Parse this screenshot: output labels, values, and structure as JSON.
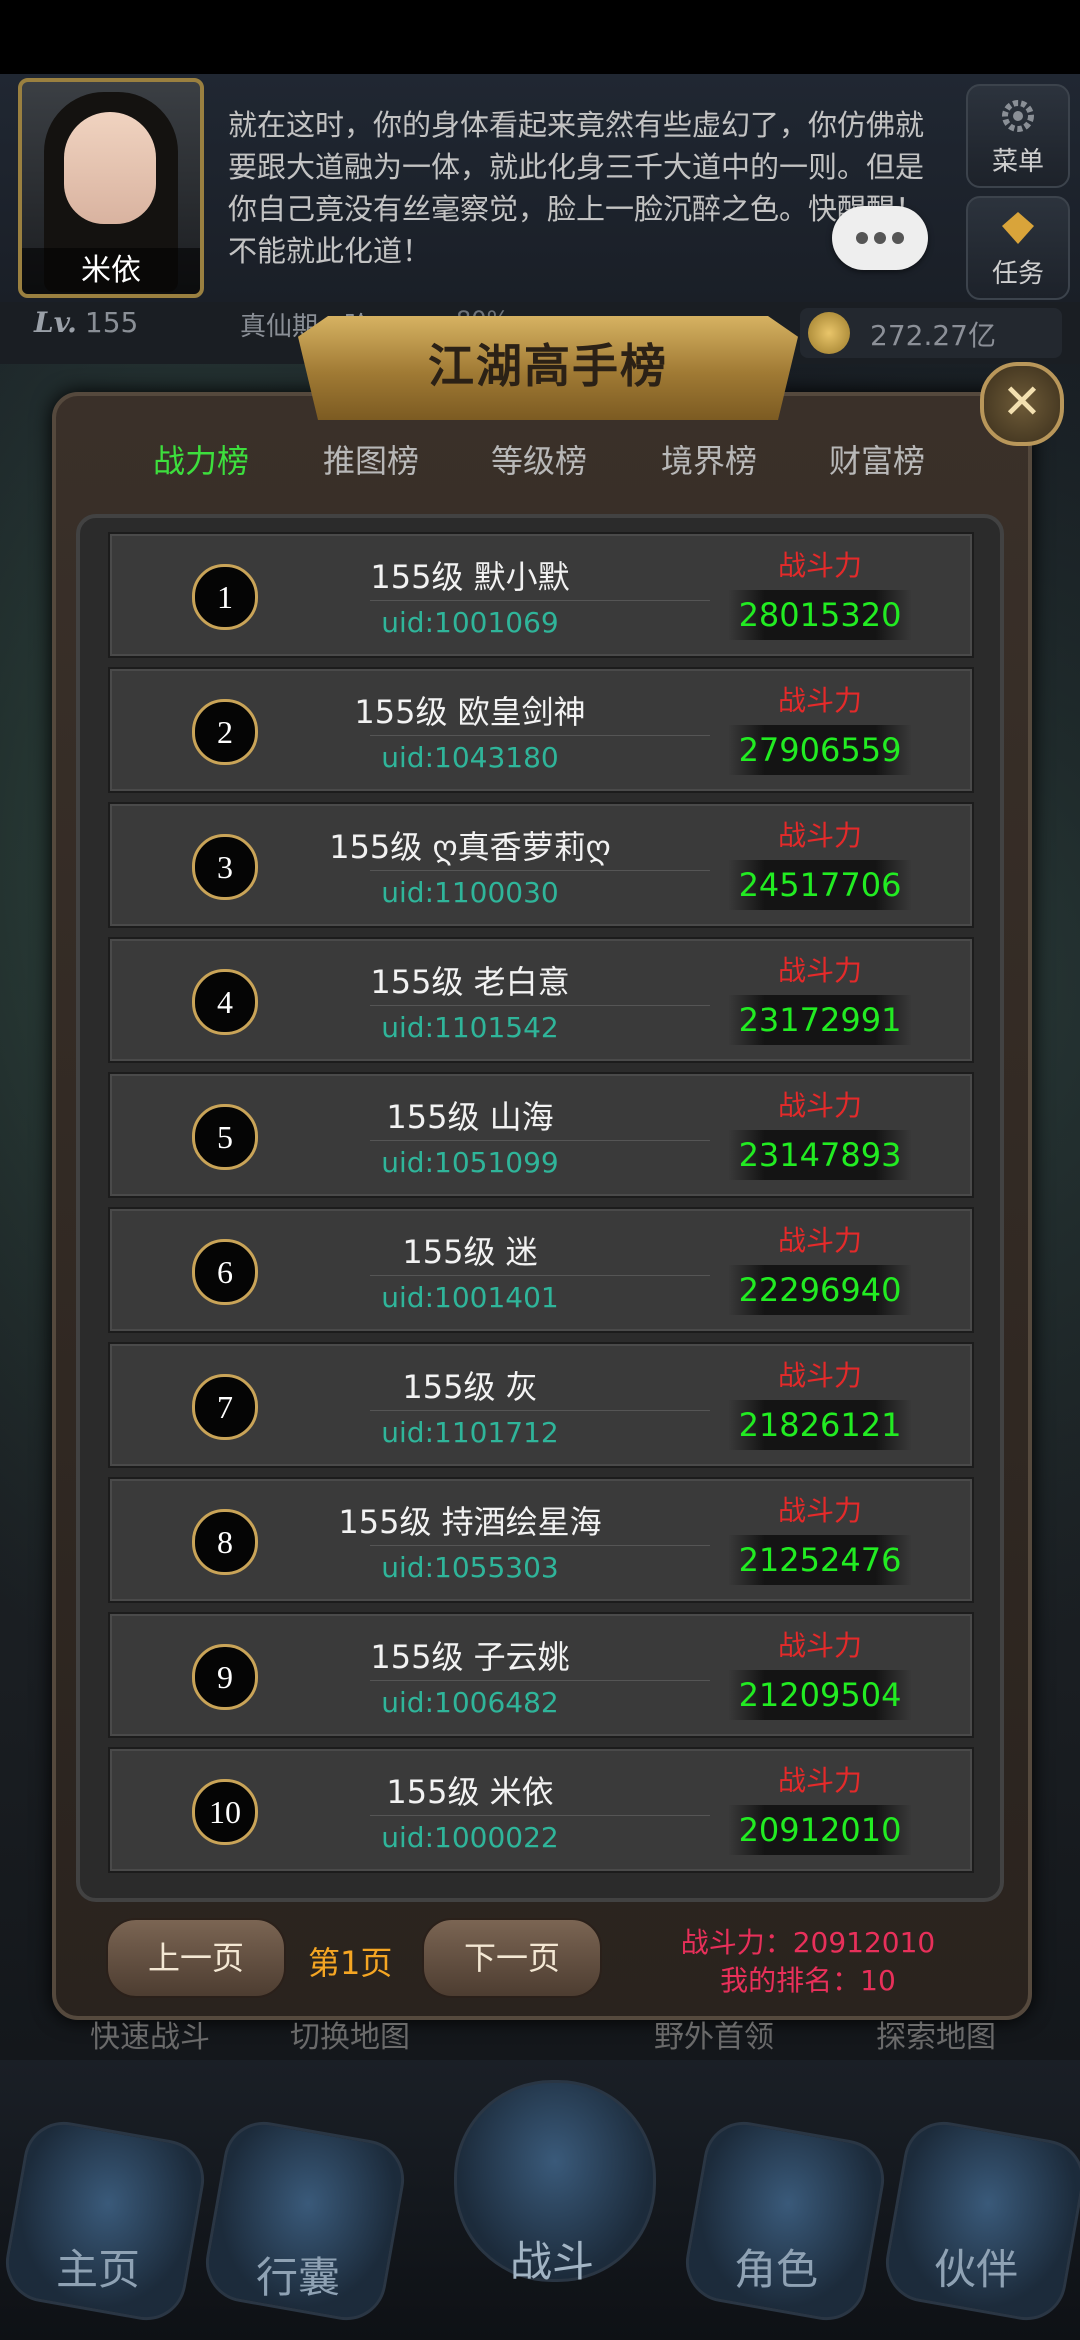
{
  "header": {
    "avatar_name": "米依",
    "dialogue": "就在这时，你的身体看起来竟然有些虚幻了，你仿佛就要跟大道融为一体，就此化身三千大道中的一则。但是你自己竟没有丝毫察觉，脸上一脸沉醉之色。快醒醒！不能就此化道！",
    "menu_label": "菜单",
    "task_label": "任务"
  },
  "stats": {
    "lv_prefix": "Lv.",
    "level": "155",
    "realm": "真仙期一阶",
    "realm_pct": "80%",
    "gold": "272.27亿"
  },
  "panel": {
    "title": "江湖高手榜",
    "close_label": "✕",
    "tabs": [
      "战力榜",
      "推图榜",
      "等级榜",
      "境界榜",
      "财富榜"
    ],
    "active_tab": 0,
    "power_label": "战斗力",
    "rows": [
      {
        "rank": "1",
        "name": "155级 默小默",
        "uid": "uid:1001069",
        "power": "28015320"
      },
      {
        "rank": "2",
        "name": "155级 欧皇剑神",
        "uid": "uid:1043180",
        "power": "27906559"
      },
      {
        "rank": "3",
        "name": "155级 ღ真香萝莉ღ",
        "uid": "uid:1100030",
        "power": "24517706"
      },
      {
        "rank": "4",
        "name": "155级 老白意",
        "uid": "uid:1101542",
        "power": "23172991"
      },
      {
        "rank": "5",
        "name": "155级 山海",
        "uid": "uid:1051099",
        "power": "23147893"
      },
      {
        "rank": "6",
        "name": "155级 迷",
        "uid": "uid:1001401",
        "power": "22296940"
      },
      {
        "rank": "7",
        "name": "155级 灰",
        "uid": "uid:1101712",
        "power": "21826121"
      },
      {
        "rank": "8",
        "name": "155级 持酒绘星海",
        "uid": "uid:1055303",
        "power": "21252476"
      },
      {
        "rank": "9",
        "name": "155级 子云姚",
        "uid": "uid:1006482",
        "power": "21209504"
      },
      {
        "rank": "10",
        "name": "155级 米依",
        "uid": "uid:1000022",
        "power": "20912010"
      }
    ],
    "prev_label": "上一页",
    "page_label": "第1页",
    "next_label": "下一页",
    "my_power": "战斗力：20912010",
    "my_rank": "我的排名：10"
  },
  "below": {
    "items": [
      "快速战斗",
      "切换地图",
      "野外首领",
      "探索地图"
    ]
  },
  "nav": {
    "items": [
      "主页",
      "行囊",
      "战斗",
      "角色",
      "伙伴"
    ]
  }
}
